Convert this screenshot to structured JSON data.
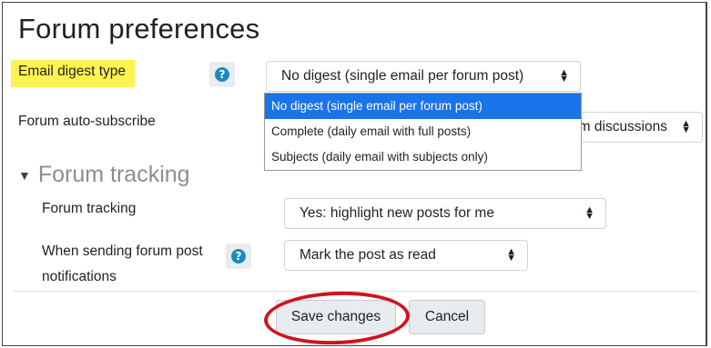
{
  "page_title": "Forum preferences",
  "fields": {
    "email_digest": {
      "label": "Email digest type",
      "value": "No digest (single email per forum post)",
      "options": [
        "No digest (single email per forum post)",
        "Complete (daily email with full posts)",
        "Subjects (daily email with subjects only)"
      ]
    },
    "auto_subscribe": {
      "label": "Forum auto-subscribe",
      "value_visible": "m discussions"
    }
  },
  "tracking_section": {
    "heading": "Forum tracking",
    "forum_tracking": {
      "label": "Forum tracking",
      "value": "Yes: highlight new posts for me"
    },
    "notifications": {
      "label_line1": "When sending forum post",
      "label_line2": "notifications",
      "value": "Mark the post as read"
    }
  },
  "buttons": {
    "save": "Save changes",
    "cancel": "Cancel"
  },
  "colors": {
    "highlight": "#fff44f",
    "selected_option": "#1a73e8",
    "annotation": "#d0141a",
    "help": "#1b8abf"
  },
  "icons": {
    "help": "question-circle-icon",
    "section_toggle": "triangle-down-icon",
    "select_caret": "updown-caret-icon"
  }
}
